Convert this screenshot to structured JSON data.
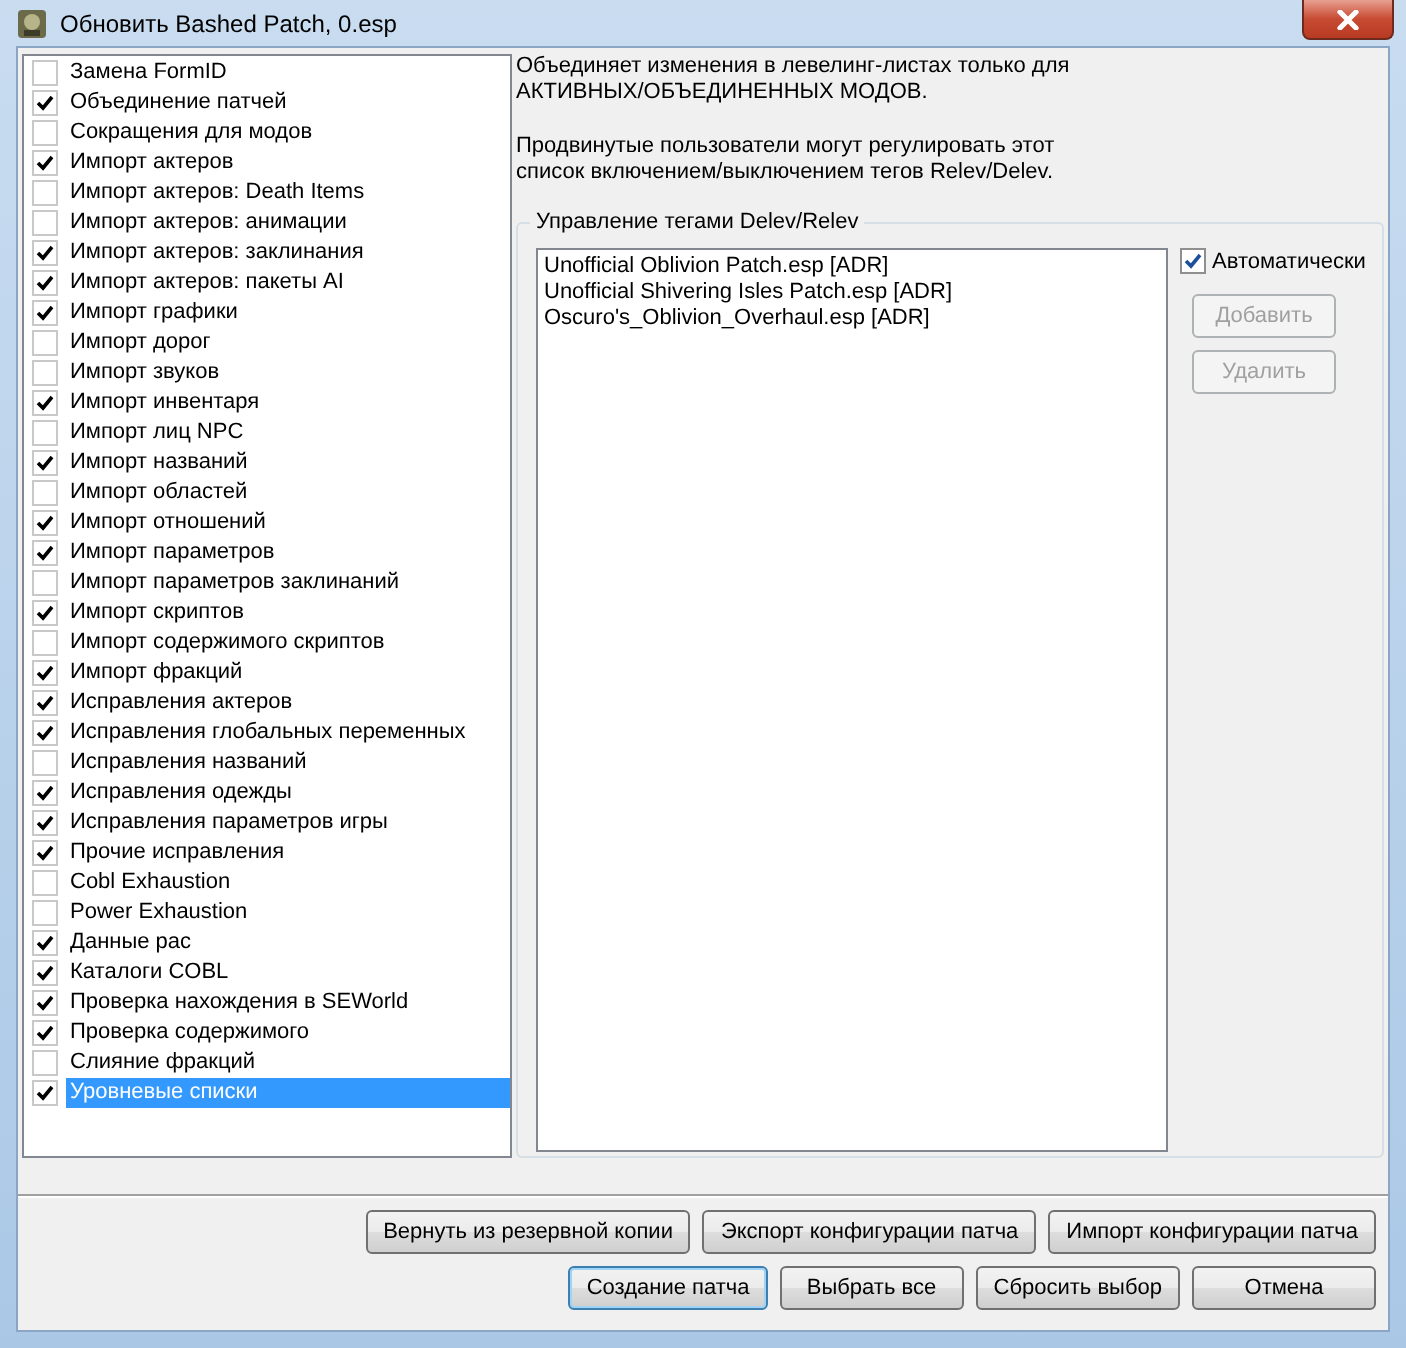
{
  "window": {
    "title": "Обновить Bashed Patch, 0.esp"
  },
  "patchers": [
    {
      "label": "Замена FormID",
      "checked": false,
      "selected": false
    },
    {
      "label": "Объединение патчей",
      "checked": true,
      "selected": false
    },
    {
      "label": "Сокращения для модов",
      "checked": false,
      "selected": false
    },
    {
      "label": "Импорт актеров",
      "checked": true,
      "selected": false
    },
    {
      "label": "Импорт актеров: Death Items",
      "checked": false,
      "selected": false
    },
    {
      "label": "Импорт актеров: анимации",
      "checked": false,
      "selected": false
    },
    {
      "label": "Импорт актеров: заклинания",
      "checked": true,
      "selected": false
    },
    {
      "label": "Импорт актеров: пакеты AI",
      "checked": true,
      "selected": false
    },
    {
      "label": "Импорт графики",
      "checked": true,
      "selected": false
    },
    {
      "label": "Импорт дорог",
      "checked": false,
      "selected": false
    },
    {
      "label": "Импорт звуков",
      "checked": false,
      "selected": false
    },
    {
      "label": "Импорт инвентаря",
      "checked": true,
      "selected": false
    },
    {
      "label": "Импорт лиц NPC",
      "checked": false,
      "selected": false
    },
    {
      "label": "Импорт названий",
      "checked": true,
      "selected": false
    },
    {
      "label": "Импорт областей",
      "checked": false,
      "selected": false
    },
    {
      "label": "Импорт отношений",
      "checked": true,
      "selected": false
    },
    {
      "label": "Импорт параметров",
      "checked": true,
      "selected": false
    },
    {
      "label": "Импорт параметров заклинаний",
      "checked": false,
      "selected": false
    },
    {
      "label": "Импорт скриптов",
      "checked": true,
      "selected": false
    },
    {
      "label": "Импорт содержимого скриптов",
      "checked": false,
      "selected": false
    },
    {
      "label": "Импорт фракций",
      "checked": true,
      "selected": false
    },
    {
      "label": "Исправления актеров",
      "checked": true,
      "selected": false
    },
    {
      "label": "Исправления глобальных переменных",
      "checked": true,
      "selected": false
    },
    {
      "label": "Исправления названий",
      "checked": false,
      "selected": false
    },
    {
      "label": "Исправления одежды",
      "checked": true,
      "selected": false
    },
    {
      "label": "Исправления параметров игры",
      "checked": true,
      "selected": false
    },
    {
      "label": "Прочие исправления",
      "checked": true,
      "selected": false
    },
    {
      "label": "Cobl Exhaustion",
      "checked": false,
      "selected": false
    },
    {
      "label": "Power Exhaustion",
      "checked": false,
      "selected": false
    },
    {
      "label": "Данные рас",
      "checked": true,
      "selected": false
    },
    {
      "label": "Каталоги COBL",
      "checked": true,
      "selected": false
    },
    {
      "label": "Проверка нахождения в SEWorld",
      "checked": true,
      "selected": false
    },
    {
      "label": "Проверка содержимого",
      "checked": true,
      "selected": false
    },
    {
      "label": "Слияние фракций",
      "checked": false,
      "selected": false
    },
    {
      "label": "Уровневые списки",
      "checked": true,
      "selected": true
    }
  ],
  "description": [
    "Объединяет изменения в левелинг-листах только для АКТИВНЫХ/ОБЪЕДИНЕННЫХ МОДОВ.",
    "Продвинутые пользователи могут регулировать этот список включением/выключением тегов Relev/Delev."
  ],
  "tags_group": {
    "title": "Управление тегами Delev/Relev",
    "items": [
      "Unofficial Oblivion Patch.esp [ADR]",
      "Unofficial Shivering Isles Patch.esp [ADR]",
      "Oscuro's_Oblivion_Overhaul.esp [ADR]"
    ],
    "auto": {
      "label": "Автоматически",
      "checked": true
    },
    "buttons": [
      {
        "label": "Добавить",
        "disabled": true
      },
      {
        "label": "Удалить",
        "disabled": true
      }
    ]
  },
  "buttons_row1": [
    {
      "label": "Вернуть из резервной копии",
      "default": false
    },
    {
      "label": "Экспорт конфигурации патча",
      "default": false
    },
    {
      "label": "Импорт конфигурации патча",
      "default": false
    }
  ],
  "buttons_row2": [
    {
      "label": "Создание патча",
      "default": true
    },
    {
      "label": "Выбрать все",
      "default": false
    },
    {
      "label": "Сбросить выбор",
      "default": false
    },
    {
      "label": "Отмена",
      "default": false
    }
  ]
}
